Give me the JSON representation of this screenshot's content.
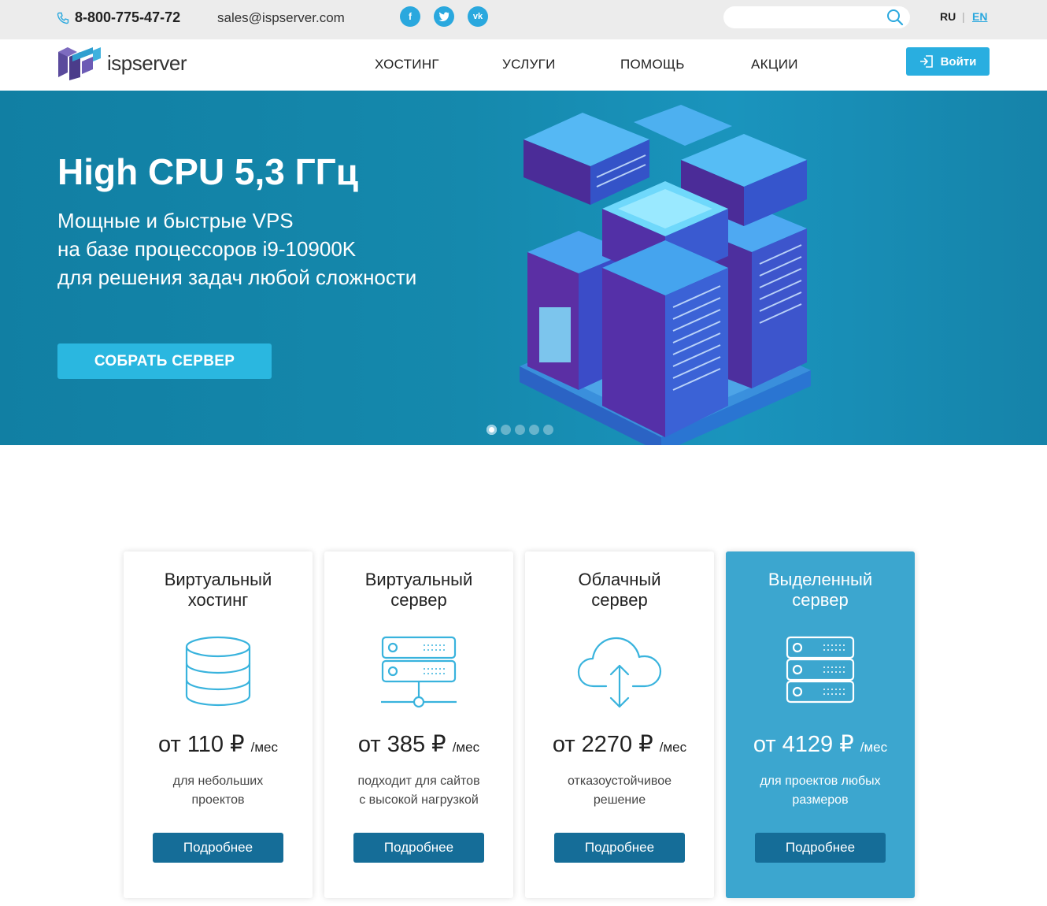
{
  "topbar": {
    "phone": "8-800-775-47-72",
    "email": "sales@ispserver.com",
    "social": [
      {
        "icon": "facebook-icon",
        "glyph": "f"
      },
      {
        "icon": "twitter-icon",
        "glyph": "t"
      },
      {
        "icon": "vk-icon",
        "glyph": "vk"
      }
    ],
    "search_placeholder": "",
    "lang_ru": "RU",
    "lang_sep": "|",
    "lang_en": "EN"
  },
  "nav": {
    "logo_text": "ispserver",
    "items": [
      "ХОСТИНГ",
      "УСЛУГИ",
      "ПОМОЩЬ",
      "АКЦИИ"
    ],
    "login_label": "Войти"
  },
  "hero": {
    "title": "High CPU 5,3 ГГц",
    "lines": [
      "Мощные и быстрые VPS",
      "на базе процессоров i9-10900K",
      "для решения задач любой сложности"
    ],
    "button": "СОБРАТЬ СЕРВЕР",
    "slides_total": 5,
    "active_slide": 1
  },
  "cards": [
    {
      "title_1": "Виртуальный",
      "title_2": "хостинг",
      "price": "от 110 ₽",
      "unit": "/мес",
      "desc_1": "для небольших",
      "desc_2": "проектов",
      "button": "Подробнее",
      "icon": "database-icon"
    },
    {
      "title_1": "Виртуальный",
      "title_2": "сервер",
      "price": "от 385 ₽",
      "unit": "/мес",
      "desc_1": "подходит для сайтов",
      "desc_2": "с высокой нагрузкой",
      "button": "Подробнее",
      "icon": "server-network-icon"
    },
    {
      "title_1": "Облачный",
      "title_2": "сервер",
      "price": "от 2270 ₽",
      "unit": "/мес",
      "desc_1": "отказоустойчивое",
      "desc_2": "решение",
      "button": "Подробнее",
      "icon": "cloud-upload-icon"
    },
    {
      "title_1": "Выделенный",
      "title_2": "сервер",
      "price": "от 4129 ₽",
      "unit": "/мес",
      "desc_1": "для проектов любых",
      "desc_2": "размеров",
      "button": "Подробнее",
      "icon": "server-rack-icon"
    }
  ],
  "colors": {
    "accent": "#29aee0",
    "hero_bg": "#1589ad",
    "featured_card": "#3ca6cf",
    "card_button": "#156d98",
    "icon_line": "#39b3dd"
  }
}
